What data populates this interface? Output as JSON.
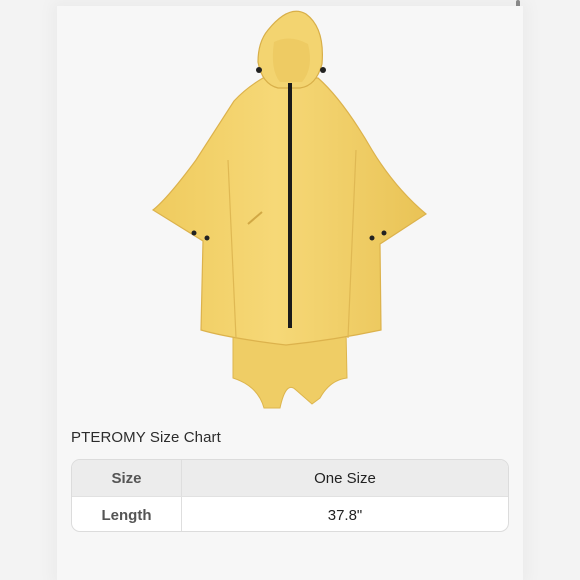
{
  "size_chart": {
    "title": "PTEROMY Size Chart",
    "rows": [
      {
        "label": "Size",
        "value": "One Size"
      },
      {
        "label": "Length",
        "value": "37.8\""
      }
    ]
  },
  "colors": {
    "poncho": "#f1d16a",
    "poncho_shadow": "#dcb44d",
    "zipper": "#1a1a1a"
  }
}
